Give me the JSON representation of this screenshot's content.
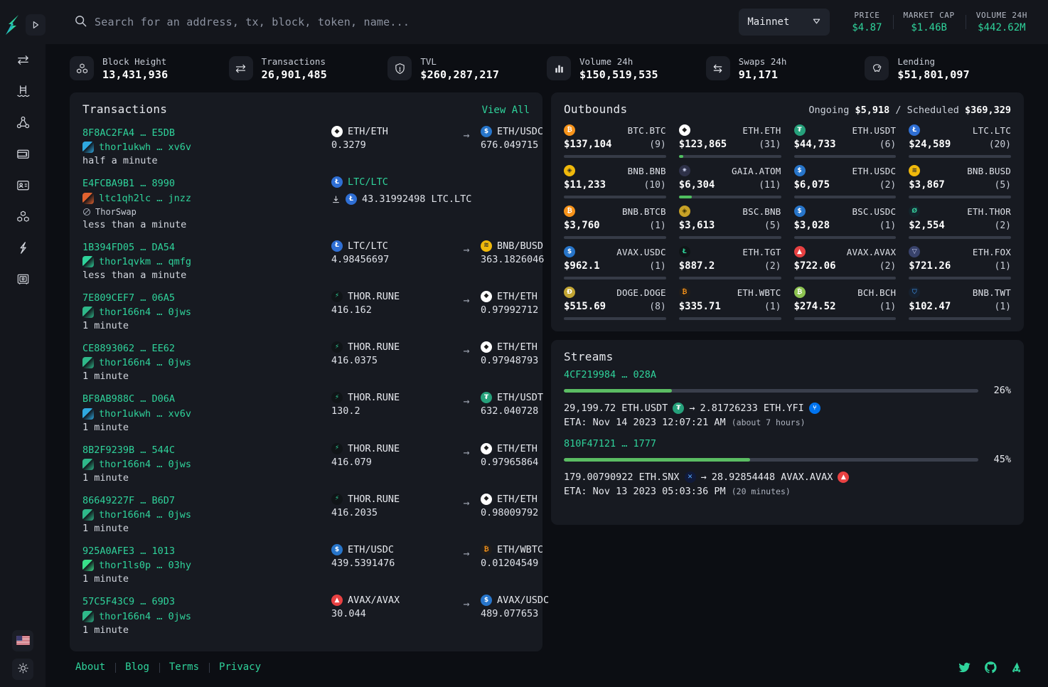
{
  "brand": {
    "logo_icon": "thorchain-bolt-logo",
    "collapse_icon": "sidebar-collapse-icon"
  },
  "sidebar": {
    "items": [
      {
        "icon": "swap-icon",
        "name": "sidebar-item-swap"
      },
      {
        "icon": "pool-icon",
        "name": "sidebar-item-pools"
      },
      {
        "icon": "nodes-icon",
        "name": "sidebar-item-nodes"
      },
      {
        "icon": "wallet-icon",
        "name": "sidebar-item-wallet"
      },
      {
        "icon": "address-card-icon",
        "name": "sidebar-item-addresses"
      },
      {
        "icon": "blocks-icon",
        "name": "sidebar-item-blocks"
      },
      {
        "icon": "lightning-icon",
        "name": "sidebar-item-thorchain"
      },
      {
        "icon": "vault-icon",
        "name": "sidebar-item-vaults"
      }
    ],
    "bottom": [
      {
        "icon": "us-flag-icon",
        "name": "language-button"
      },
      {
        "icon": "sun-icon",
        "name": "theme-toggle-button"
      }
    ]
  },
  "search": {
    "placeholder": "Search for an address, tx, block, token, name...",
    "value": "",
    "icon": "search-icon"
  },
  "network": {
    "label": "Mainnet",
    "chevron": "chevron-down-icon"
  },
  "header_stats": [
    {
      "key": "PRICE",
      "value": "$4.87"
    },
    {
      "key": "MARKET CAP",
      "value": "$1.46B"
    },
    {
      "key": "VOLUME 24H",
      "value": "$442.62M"
    }
  ],
  "strip": [
    {
      "icon": "blocks-icon",
      "label": "Block Height",
      "value": "13,431,936"
    },
    {
      "icon": "swap-icon",
      "label": "Transactions",
      "value": "26,901,485"
    },
    {
      "icon": "shield-icon",
      "label": "TVL",
      "value": "$260,287,217"
    },
    {
      "icon": "bar-chart-icon",
      "label": "Volume 24h",
      "value": "$150,519,535"
    },
    {
      "icon": "exchange-icon",
      "label": "Swaps 24h",
      "value": "91,171"
    },
    {
      "icon": "piggy-bank-icon",
      "label": "Lending",
      "value": "$51,801,097"
    }
  ],
  "transactions": {
    "title": "Transactions",
    "view_all": "View All",
    "rows": [
      {
        "hash": "8F8AC2FA4 … E5DB",
        "address": "thor1ukwh … xv6v",
        "avatar_color": "#2fa8e0",
        "time": "half a minute",
        "memo": null,
        "in": {
          "asset": "ETH/ETH",
          "amount": "0.3279",
          "coin": "ETH"
        },
        "out": {
          "asset": "ETH/USDC",
          "amount": "676.049715",
          "coin": "USDC"
        },
        "arrow": "→",
        "refund": null
      },
      {
        "hash": "E4FCBA9B1 … 8990",
        "address": "ltc1qh2lc … jnzz",
        "avatar_color": "#e0622f",
        "time": "less than a minute",
        "memo": "ThorSwap",
        "in": {
          "asset": "LTC/LTC",
          "amount": "",
          "coin": "LTC",
          "green": true
        },
        "out": null,
        "arrow": "",
        "refund": {
          "amount": "43.31992498 LTC.LTC",
          "coin": "LTC"
        }
      },
      {
        "hash": "1B394FD05 … DA54",
        "address": "thor1qvkm … qmfg",
        "avatar_color": "#2fd39b",
        "time": "less than a minute",
        "memo": null,
        "in": {
          "asset": "LTC/LTC",
          "amount": "4.98456697",
          "coin": "LTC"
        },
        "out": {
          "asset": "BNB/BUSD",
          "amount": "363.1826046",
          "coin": "BUSD"
        },
        "arrow": "→",
        "refund": null
      },
      {
        "hash": "7E809CEF7 … 06A5",
        "address": "thor166n4 … 0jws",
        "avatar_color": "#2fb98a",
        "time": "1 minute",
        "memo": null,
        "in": {
          "asset": "THOR.RUNE",
          "amount": "416.162",
          "coin": "RUNE"
        },
        "out": {
          "asset": "ETH/ETH",
          "amount": "0.97992712",
          "coin": "ETH"
        },
        "arrow": "→",
        "refund": null
      },
      {
        "hash": "CE8893062 … EE62",
        "address": "thor166n4 … 0jws",
        "avatar_color": "#2fb98a",
        "time": "1 minute",
        "memo": null,
        "in": {
          "asset": "THOR.RUNE",
          "amount": "416.0375",
          "coin": "RUNE"
        },
        "out": {
          "asset": "ETH/ETH",
          "amount": "0.97948793",
          "coin": "ETH"
        },
        "arrow": "→",
        "refund": null
      },
      {
        "hash": "BF8AB988C … D06A",
        "address": "thor1ukwh … xv6v",
        "avatar_color": "#2fa8e0",
        "time": "1 minute",
        "memo": null,
        "in": {
          "asset": "THOR.RUNE",
          "amount": "130.2",
          "coin": "RUNE"
        },
        "out": {
          "asset": "ETH/USDT",
          "amount": "632.040728",
          "coin": "USDT"
        },
        "arrow": "→",
        "refund": null
      },
      {
        "hash": "8B2F9239B … 544C",
        "address": "thor166n4 … 0jws",
        "avatar_color": "#2fb98a",
        "time": "1 minute",
        "memo": null,
        "in": {
          "asset": "THOR.RUNE",
          "amount": "416.079",
          "coin": "RUNE"
        },
        "out": {
          "asset": "ETH/ETH",
          "amount": "0.97965864",
          "coin": "ETH"
        },
        "arrow": "→",
        "refund": null
      },
      {
        "hash": "86649227F … B6D7",
        "address": "thor166n4 … 0jws",
        "avatar_color": "#2fb98a",
        "time": "1 minute",
        "memo": null,
        "in": {
          "asset": "THOR.RUNE",
          "amount": "416.2035",
          "coin": "RUNE"
        },
        "out": {
          "asset": "ETH/ETH",
          "amount": "0.98009792",
          "coin": "ETH"
        },
        "arrow": "→",
        "refund": null
      },
      {
        "hash": "925A0AFE3 … 1013",
        "address": "thor1ls0p … 03hy",
        "avatar_color": "#39e08a",
        "time": "1 minute",
        "memo": null,
        "in": {
          "asset": "ETH/USDC",
          "amount": "439.5391476",
          "coin": "USDC"
        },
        "out": {
          "asset": "ETH/WBTC",
          "amount": "0.01204549",
          "coin": "WBTC"
        },
        "arrow": "→",
        "refund": null
      },
      {
        "hash": "57C5F43C9 … 69D3",
        "address": "thor166n4 … 0jws",
        "avatar_color": "#2fb98a",
        "time": "1 minute",
        "memo": null,
        "in": {
          "asset": "AVAX/AVAX",
          "amount": "30.044",
          "coin": "AVAX"
        },
        "out": {
          "asset": "AVAX/USDC",
          "amount": "489.077653",
          "coin": "USDC"
        },
        "arrow": "→",
        "refund": null
      }
    ]
  },
  "outbounds": {
    "title": "Outbounds",
    "ongoing_label": "Ongoing",
    "ongoing_value": "$5,918",
    "separator": "/",
    "scheduled_label": "Scheduled",
    "scheduled_value": "$369,329",
    "items": [
      {
        "symbol": "BTC.BTC",
        "value": "$137,104",
        "count": "(9)",
        "pct": 0,
        "coin": "BTC"
      },
      {
        "symbol": "ETH.ETH",
        "value": "$123,865",
        "count": "(31)",
        "pct": 4,
        "coin": "ETH"
      },
      {
        "symbol": "ETH.USDT",
        "value": "$44,733",
        "count": "(6)",
        "pct": 0,
        "coin": "USDT"
      },
      {
        "symbol": "LTC.LTC",
        "value": "$24,589",
        "count": "(20)",
        "pct": 0,
        "coin": "LTC"
      },
      {
        "symbol": "BNB.BNB",
        "value": "$11,233",
        "count": "(10)",
        "pct": 0,
        "coin": "BNB"
      },
      {
        "symbol": "GAIA.ATOM",
        "value": "$6,304",
        "count": "(11)",
        "pct": 13,
        "coin": "ATOM"
      },
      {
        "symbol": "ETH.USDC",
        "value": "$6,075",
        "count": "(2)",
        "pct": 0,
        "coin": "USDC"
      },
      {
        "symbol": "BNB.BUSD",
        "value": "$3,867",
        "count": "(5)",
        "pct": 0,
        "coin": "BUSD"
      },
      {
        "symbol": "BNB.BTCB",
        "value": "$3,760",
        "count": "(1)",
        "pct": 0,
        "coin": "BTC"
      },
      {
        "symbol": "BSC.BNB",
        "value": "$3,613",
        "count": "(5)",
        "pct": 0,
        "coin": "BNB2"
      },
      {
        "symbol": "BSC.USDC",
        "value": "$3,028",
        "count": "(1)",
        "pct": 0,
        "coin": "USDC"
      },
      {
        "symbol": "ETH.THOR",
        "value": "$2,554",
        "count": "(2)",
        "pct": 0,
        "coin": "THOR"
      },
      {
        "symbol": "AVAX.USDC",
        "value": "$962.1",
        "count": "(1)",
        "pct": 0,
        "coin": "USDC"
      },
      {
        "symbol": "ETH.TGT",
        "value": "$887.2",
        "count": "(2)",
        "pct": 0,
        "coin": "TGT"
      },
      {
        "symbol": "AVAX.AVAX",
        "value": "$722.06",
        "count": "(2)",
        "pct": 0,
        "coin": "AVAX"
      },
      {
        "symbol": "ETH.FOX",
        "value": "$721.26",
        "count": "(1)",
        "pct": 0,
        "coin": "FOX"
      },
      {
        "symbol": "DOGE.DOGE",
        "value": "$515.69",
        "count": "(8)",
        "pct": 0,
        "coin": "DOGE"
      },
      {
        "symbol": "ETH.WBTC",
        "value": "$335.71",
        "count": "(1)",
        "pct": 0,
        "coin": "WBTC"
      },
      {
        "symbol": "BCH.BCH",
        "value": "$274.52",
        "count": "(1)",
        "pct": 0,
        "coin": "BCH"
      },
      {
        "symbol": "BNB.TWT",
        "value": "$102.47",
        "count": "(1)",
        "pct": 0,
        "coin": "TWT"
      }
    ]
  },
  "streams": {
    "title": "Streams",
    "items": [
      {
        "hash": "4CF219984 … 028A",
        "pct_label": "26%",
        "pct": 26,
        "from_amount": "29,199.72 ETH.USDT",
        "from_coin": "USDT",
        "arrow": "→",
        "to_amount": "2.81726233 ETH.YFI",
        "to_coin": "YFI",
        "eta": "ETA: Nov 14 2023 12:07:21 AM",
        "eta_rel": "(about 7 hours)"
      },
      {
        "hash": "810F47121 … 1777",
        "pct_label": "45%",
        "pct": 45,
        "from_amount": "179.00790922 ETH.SNX",
        "from_coin": "SNX",
        "arrow": "→",
        "to_amount": "28.92854448 AVAX.AVAX",
        "to_coin": "AVAX",
        "eta": "ETA: Nov 13 2023 05:03:36 PM",
        "eta_rel": "(20 minutes)"
      }
    ]
  },
  "footer": {
    "links": [
      "About",
      "Blog",
      "Terms",
      "Privacy"
    ],
    "socials": [
      {
        "icon": "twitter-icon"
      },
      {
        "icon": "github-icon"
      },
      {
        "icon": "discord-icon"
      }
    ]
  },
  "colors": {
    "accent": "#2fd39b",
    "panel": "#171a21",
    "background": "#0c0e13",
    "bar_fill": "#5bbd63"
  }
}
